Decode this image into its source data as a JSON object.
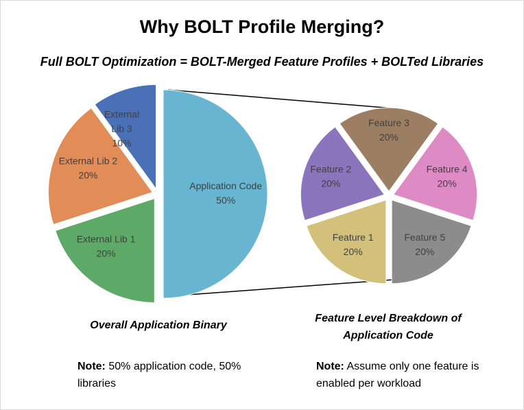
{
  "title": "Why BOLT Profile Merging?",
  "subtitle": "Full BOLT Optimization = BOLT-Merged Feature Profiles + BOLTed Libraries",
  "left_caption": "Overall Application Binary",
  "right_caption_line1": "Feature Level Breakdown of",
  "right_caption_line2": "Application Code",
  "note_left": {
    "label": "Note:",
    "text": "50% application code, 50% libraries"
  },
  "note_right": {
    "label": "Note:",
    "text": "Assume only one feature is enabled per workload"
  },
  "chart_data": [
    {
      "type": "pie",
      "title": "Overall Application Binary",
      "slices": [
        {
          "label": "Application Code",
          "label_lines": [
            "Application Code"
          ],
          "value": 50,
          "value_label": "50%",
          "color": "#67b5d1",
          "exploded": true
        },
        {
          "label": "External Lib 1",
          "label_lines": [
            "External Lib 1"
          ],
          "value": 20,
          "value_label": "20%",
          "color": "#5daa68"
        },
        {
          "label": "External Lib 2",
          "label_lines": [
            "External Lib 2"
          ],
          "value": 20,
          "value_label": "20%",
          "color": "#e28d57"
        },
        {
          "label": "External Lib 3",
          "label_lines": [
            "External",
            "Lib 3"
          ],
          "value": 10,
          "value_label": "10%",
          "color": "#4a70b8"
        }
      ]
    },
    {
      "type": "pie",
      "title": "Feature Level Breakdown of Application Code",
      "slices": [
        {
          "label": "Feature 3",
          "label_lines": [
            "Feature 3"
          ],
          "value": 20,
          "value_label": "20%",
          "color": "#9c7e63"
        },
        {
          "label": "Feature 4",
          "label_lines": [
            "Feature 4"
          ],
          "value": 20,
          "value_label": "20%",
          "color": "#de8bc5"
        },
        {
          "label": "Feature 5",
          "label_lines": [
            "Feature 5"
          ],
          "value": 20,
          "value_label": "20%",
          "color": "#8c8c8c"
        },
        {
          "label": "Feature 1",
          "label_lines": [
            "Feature 1"
          ],
          "value": 20,
          "value_label": "20%",
          "color": "#d3c17b"
        },
        {
          "label": "Feature 2",
          "label_lines": [
            "Feature 2"
          ],
          "value": 20,
          "value_label": "20%",
          "color": "#8a75bd"
        }
      ]
    }
  ]
}
